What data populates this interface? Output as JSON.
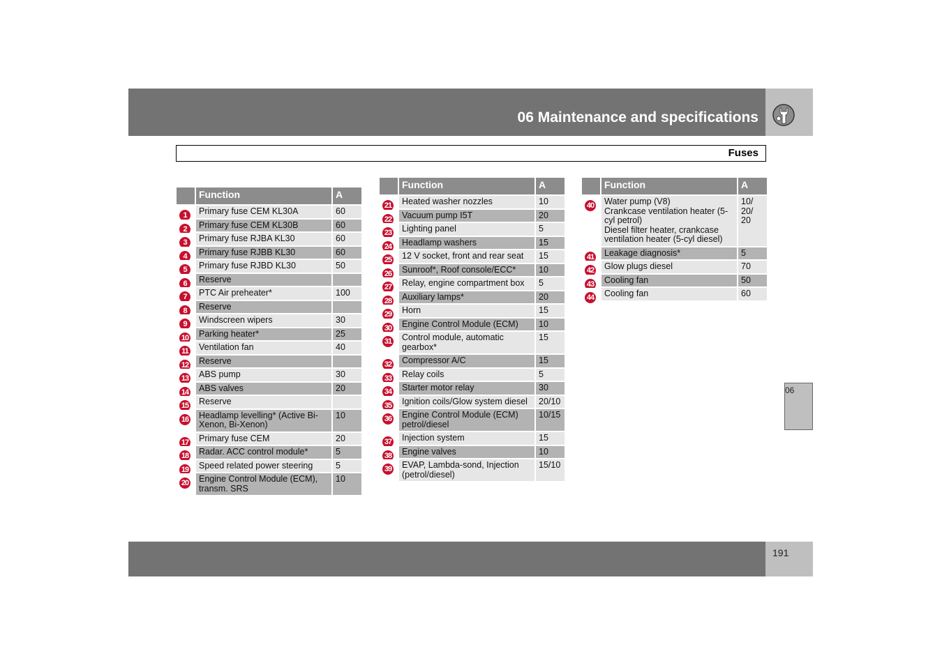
{
  "header": {
    "title": "06 Maintenance and specifications",
    "icon": "wrench-icon"
  },
  "section": {
    "title": "Fuses"
  },
  "columns": {
    "function": "Function",
    "amps": "A"
  },
  "tables": [
    {
      "rows": [
        {
          "num": "1",
          "function": "Primary fuse CEM KL30A",
          "amps": "60"
        },
        {
          "num": "2",
          "function": "Primary fuse CEM KL30B",
          "amps": "60"
        },
        {
          "num": "3",
          "function": "Primary fuse RJBA KL30",
          "amps": "60"
        },
        {
          "num": "4",
          "function": "Primary fuse RJBB KL30",
          "amps": "60"
        },
        {
          "num": "5",
          "function": "Primary fuse RJBD KL30",
          "amps": "50"
        },
        {
          "num": "6",
          "function": "Reserve",
          "amps": ""
        },
        {
          "num": "7",
          "function": "PTC Air preheater*",
          "amps": "100"
        },
        {
          "num": "8",
          "function": "Reserve",
          "amps": ""
        },
        {
          "num": "9",
          "function": "Windscreen wipers",
          "amps": "30"
        },
        {
          "num": "10",
          "function": "Parking heater*",
          "amps": "25"
        },
        {
          "num": "11",
          "function": "Ventilation fan",
          "amps": "40"
        },
        {
          "num": "12",
          "function": "Reserve",
          "amps": ""
        },
        {
          "num": "13",
          "function": "ABS pump",
          "amps": "30"
        },
        {
          "num": "14",
          "function": "ABS valves",
          "amps": "20"
        },
        {
          "num": "15",
          "function": "Reserve",
          "amps": ""
        },
        {
          "num": "16",
          "function": "Headlamp levelling* (Active Bi-Xenon, Bi-Xenon)",
          "amps": "10"
        },
        {
          "num": "17",
          "function": "Primary fuse CEM",
          "amps": "20"
        },
        {
          "num": "18",
          "function": "Radar. ACC control module*",
          "amps": "5"
        },
        {
          "num": "19",
          "function": "Speed related power steering",
          "amps": "5"
        },
        {
          "num": "20",
          "function": "Engine Control Module (ECM), transm. SRS",
          "amps": "10"
        }
      ]
    },
    {
      "rows": [
        {
          "num": "21",
          "function": "Heated washer nozzles",
          "amps": "10"
        },
        {
          "num": "22",
          "function": "Vacuum pump I5T",
          "amps": "20"
        },
        {
          "num": "23",
          "function": "Lighting panel",
          "amps": "5"
        },
        {
          "num": "24",
          "function": "Headlamp washers",
          "amps": "15"
        },
        {
          "num": "25",
          "function": "12 V socket, front and rear seat",
          "amps": "15"
        },
        {
          "num": "26",
          "function": "Sunroof*, Roof console/ECC*",
          "amps": "10"
        },
        {
          "num": "27",
          "function": "Relay, engine compartment box",
          "amps": "5"
        },
        {
          "num": "28",
          "function": "Auxiliary lamps*",
          "amps": "20"
        },
        {
          "num": "29",
          "function": "Horn",
          "amps": "15"
        },
        {
          "num": "30",
          "function": "Engine Control Module (ECM)",
          "amps": "10"
        },
        {
          "num": "31",
          "function": "Control module, automatic gearbox*",
          "amps": "15"
        },
        {
          "num": "32",
          "function": "Compressor A/C",
          "amps": "15"
        },
        {
          "num": "33",
          "function": "Relay coils",
          "amps": "5"
        },
        {
          "num": "34",
          "function": "Starter motor relay",
          "amps": "30"
        },
        {
          "num": "35",
          "function": "Ignition coils/Glow system diesel",
          "amps": "20/10"
        },
        {
          "num": "36",
          "function": "Engine Control Module (ECM) petrol/diesel",
          "amps": "10/15"
        },
        {
          "num": "37",
          "function": "Injection system",
          "amps": "15"
        },
        {
          "num": "38",
          "function": "Engine valves",
          "amps": "10"
        },
        {
          "num": "39",
          "function": "EVAP, Lambda-sond, Injection (petrol/diesel)",
          "amps": "15/10"
        }
      ]
    },
    {
      "rows": [
        {
          "num": "40",
          "function": "Water pump (V8)\nCrankcase ventilation heater (5-cyl petrol)\nDiesel filter heater, crankcase ventilation heater (5-cyl diesel)",
          "amps": "10/\n20/\n20"
        },
        {
          "num": "41",
          "function": "Leakage diagnosis*",
          "amps": "5"
        },
        {
          "num": "42",
          "function": "Glow plugs diesel",
          "amps": "70"
        },
        {
          "num": "43",
          "function": "Cooling fan",
          "amps": "50"
        },
        {
          "num": "44",
          "function": "Cooling fan",
          "amps": "60"
        }
      ]
    }
  ],
  "side_tab": {
    "label": "06"
  },
  "footer": {
    "page_number": "191"
  }
}
